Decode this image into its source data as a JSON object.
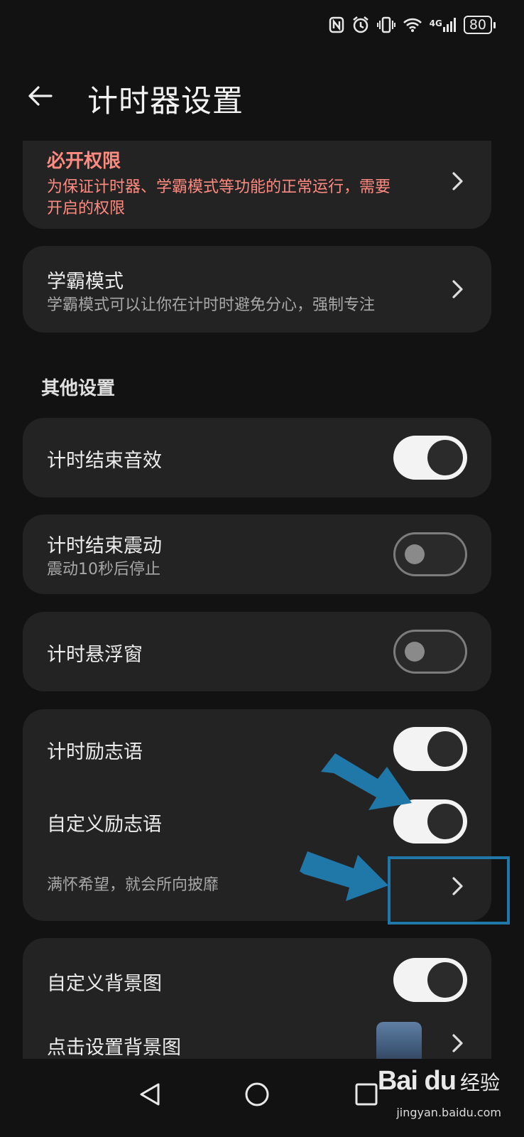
{
  "status_bar": {
    "network": "4G",
    "battery": "80"
  },
  "header": {
    "title": "计时器设置"
  },
  "cards": {
    "permissions": {
      "title": "必开权限",
      "desc_line1": "为保证计时器、学霸模式等功能的正常运行，需要",
      "desc_line2": "开启的权限"
    },
    "study_mode": {
      "title": "学霸模式",
      "desc": "学霸模式可以让你在计时时避免分心，强制专注"
    }
  },
  "section": {
    "title": "其他设置"
  },
  "settings": {
    "end_sound": {
      "label": "计时结束音效",
      "on": true
    },
    "end_vibration": {
      "label": "计时结束震动",
      "desc": "震动10秒后停止",
      "on": false
    },
    "floating_window": {
      "label": "计时悬浮窗",
      "on": false
    },
    "motto": {
      "label": "计时励志语",
      "on": true
    },
    "custom_motto": {
      "label": "自定义励志语",
      "on": true
    },
    "motto_text": {
      "label": "满怀希望，就会所向披靡"
    },
    "custom_bg": {
      "label": "自定义背景图",
      "on": true
    },
    "set_bg": {
      "label": "点击设置背景图"
    }
  },
  "colors": {
    "accent_red": "#ff8a80",
    "annotation_blue": "#1f78a8",
    "background": "#121212",
    "card": "#232323"
  },
  "watermark": {
    "brand": "Bai du",
    "cn": "经验",
    "url": "jingyan.baidu.com"
  }
}
